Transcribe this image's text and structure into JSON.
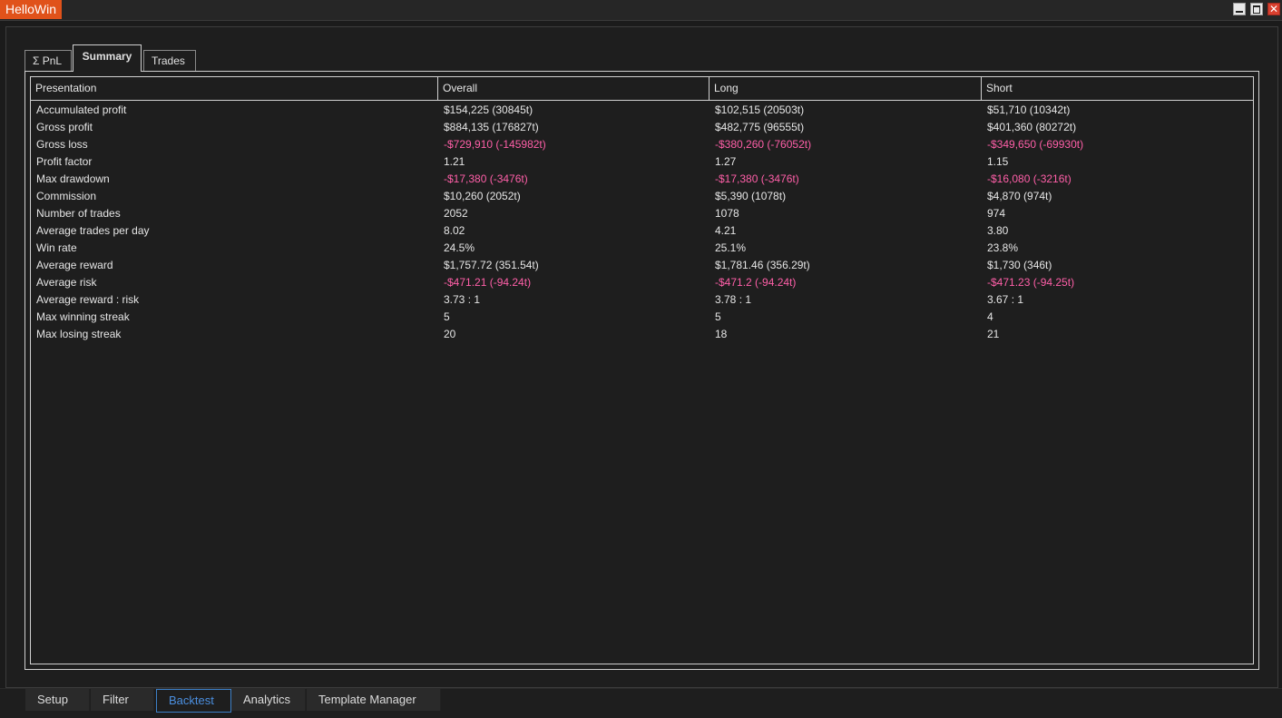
{
  "window": {
    "title": "HelloWin",
    "close_glyph": "✕"
  },
  "icons": {
    "minimize": "minimize-icon",
    "maximize": "maximize-icon",
    "close": "close-icon"
  },
  "colors": {
    "title_accent": "#e0521a",
    "negative_value": "#ff5fa8",
    "active_nav": "#4b8fe0",
    "background": "#1e1e1e"
  },
  "tabs": {
    "pnl": "Σ PnL",
    "summary": "Summary",
    "trades": "Trades",
    "active": "Summary"
  },
  "table": {
    "headers": [
      "Presentation",
      "Overall",
      "Long",
      "Short"
    ],
    "rows": [
      {
        "label": "Accumulated profit",
        "overall": "$154,225 (30845t)",
        "long": "$102,515 (20503t)",
        "short": "$51,710 (10342t)",
        "negative": false
      },
      {
        "label": "Gross profit",
        "overall": "$884,135 (176827t)",
        "long": "$482,775 (96555t)",
        "short": "$401,360 (80272t)",
        "negative": false
      },
      {
        "label": "Gross loss",
        "overall": "-$729,910 (-145982t)",
        "long": "-$380,260 (-76052t)",
        "short": "-$349,650 (-69930t)",
        "negative": true
      },
      {
        "label": "Profit factor",
        "overall": "1.21",
        "long": "1.27",
        "short": "1.15",
        "negative": false
      },
      {
        "label": "Max drawdown",
        "overall": "-$17,380 (-3476t)",
        "long": "-$17,380 (-3476t)",
        "short": "-$16,080 (-3216t)",
        "negative": true
      },
      {
        "label": "Commission",
        "overall": "$10,260 (2052t)",
        "long": "$5,390 (1078t)",
        "short": "$4,870 (974t)",
        "negative": false
      },
      {
        "label": "Number of trades",
        "overall": "2052",
        "long": "1078",
        "short": "974",
        "negative": false
      },
      {
        "label": "Average trades per day",
        "overall": "8.02",
        "long": "4.21",
        "short": "3.80",
        "negative": false
      },
      {
        "label": "Win rate",
        "overall": "24.5%",
        "long": "25.1%",
        "short": "23.8%",
        "negative": false
      },
      {
        "label": "Average reward",
        "overall": "$1,757.72 (351.54t)",
        "long": "$1,781.46 (356.29t)",
        "short": "$1,730 (346t)",
        "negative": false
      },
      {
        "label": "Average risk",
        "overall": "-$471.21 (-94.24t)",
        "long": "-$471.2 (-94.24t)",
        "short": "-$471.23 (-94.25t)",
        "negative": true
      },
      {
        "label": "Average reward : risk",
        "overall": "3.73 : 1",
        "long": "3.78 : 1",
        "short": "3.67 : 1",
        "negative": false
      },
      {
        "label": "Max winning streak",
        "overall": "5",
        "long": "5",
        "short": "4",
        "negative": false
      },
      {
        "label": "Max losing streak",
        "overall": "20",
        "long": "18",
        "short": "21",
        "negative": false
      }
    ]
  },
  "bottom_nav": {
    "setup": "Setup",
    "filter": "Filter",
    "backtest": "Backtest",
    "analytics": "Analytics",
    "template_manager": "Template Manager",
    "active": "Backtest"
  }
}
